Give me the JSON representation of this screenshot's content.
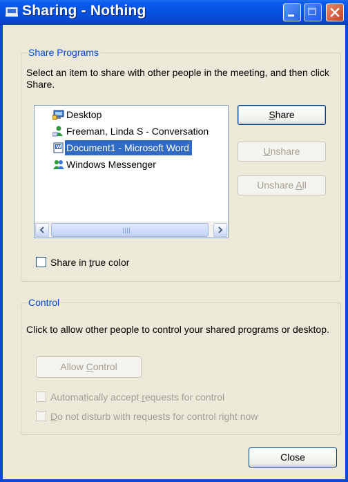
{
  "window": {
    "title": "Sharing - Nothing"
  },
  "share_programs": {
    "group_label": "Share Programs",
    "description": "Select an item to share with other people in the meeting, and then click Share.",
    "items": [
      {
        "label": "Desktop",
        "icon": "desktop-icon",
        "selected": false
      },
      {
        "label": "Freeman, Linda S - Conversation",
        "icon": "conversation-icon",
        "selected": false
      },
      {
        "label": "Document1 - Microsoft Word",
        "icon": "word-document-icon",
        "selected": true
      },
      {
        "label": "Windows Messenger",
        "icon": "messenger-icon",
        "selected": false
      }
    ],
    "share_button": {
      "pre": "",
      "key": "S",
      "post": "hare"
    },
    "unshare_button": {
      "pre": "",
      "key": "U",
      "post": "nshare"
    },
    "unshare_all_button": {
      "pre": "Unshare ",
      "key": "A",
      "post": "ll"
    },
    "true_color": {
      "pre": "Share in ",
      "key": "t",
      "post": "rue color",
      "checked": false
    }
  },
  "control": {
    "group_label": "Control",
    "description": "Click to allow other people to control your shared programs or desktop.",
    "allow_control_button": {
      "pre": "Allow ",
      "key": "C",
      "post": "ontrol"
    },
    "auto_accept": {
      "pre": "Automatically accept ",
      "key": "r",
      "post": "equests for control",
      "checked": false
    },
    "do_not_disturb": {
      "pre": "",
      "key": "D",
      "post": "o not disturb with requests for control right now",
      "checked": false
    }
  },
  "close_button": {
    "label": "Close"
  },
  "colors": {
    "titlebar": "#0650e0",
    "dialog_bg": "#ece9d8",
    "group_label": "#0046d5",
    "selection": "#316ac5"
  }
}
